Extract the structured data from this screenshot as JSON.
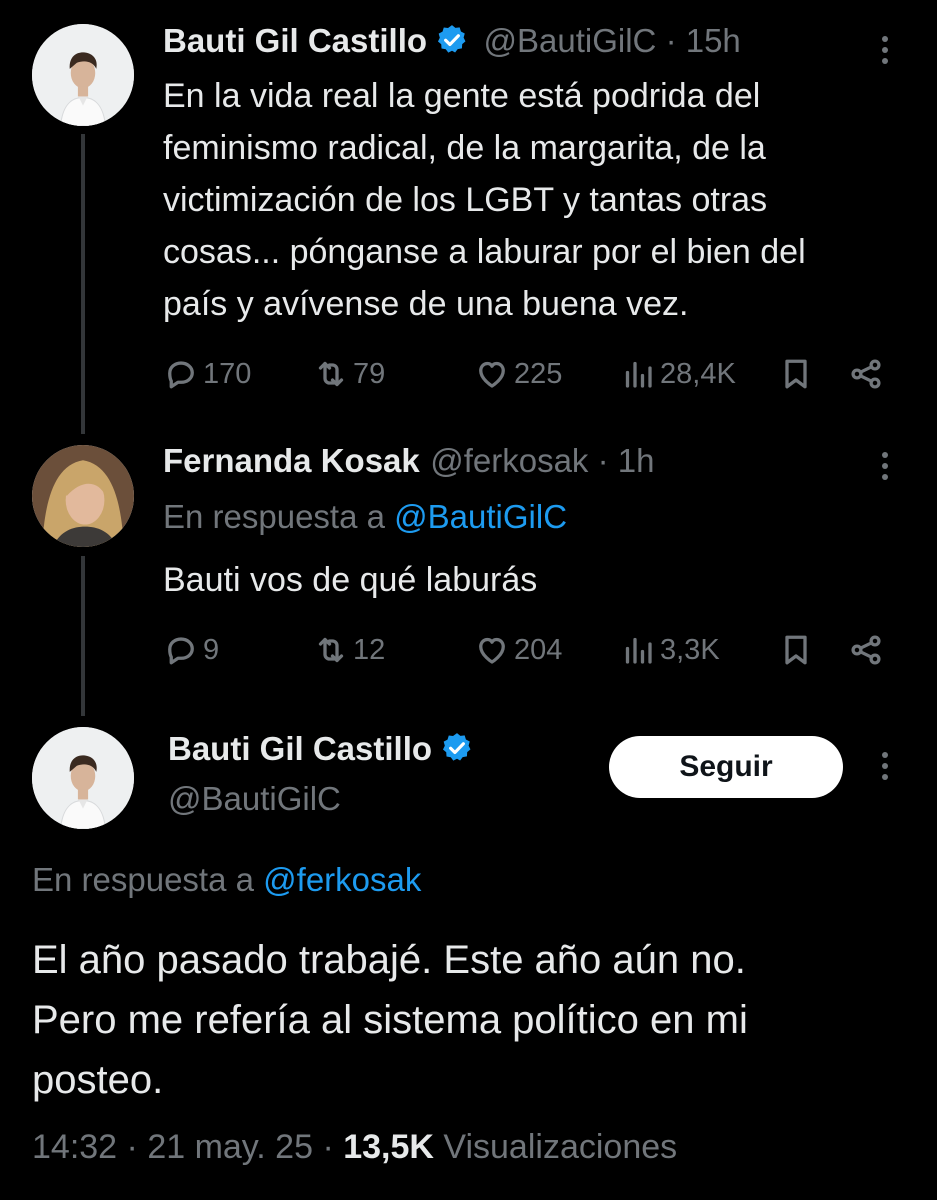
{
  "tweets": [
    {
      "author": "Bauti Gil Castillo",
      "handle": "@BautiGilC",
      "time": "· 15h",
      "lines": [
        "En la vida real la gente está podrida del",
        "feminismo radical, de la margarita, de la",
        "victimización de los LGBT y tantas otras",
        "cosas... pónganse a laburar por el bien del",
        "país y avívense de una buena vez."
      ],
      "replies": "170",
      "retweets": "79",
      "likes": "225",
      "views": "28,4K"
    },
    {
      "author": "Fernanda Kosak",
      "handle": "@ferkosak",
      "time": "· 1h",
      "reply_prefix": "En respuesta a",
      "reply_to": "@BautiGilC",
      "lines": [
        "Bauti vos de qué laburás"
      ],
      "replies": "9",
      "retweets": "12",
      "likes": "204",
      "views": "3,3K"
    }
  ],
  "main": {
    "author": "Bauti Gil Castillo",
    "handle": "@BautiGilC",
    "follow_label": "Seguir",
    "reply_prefix": "En respuesta a",
    "reply_to": "@ferkosak",
    "lines": [
      "El año pasado trabajé. Este año aún no.",
      "Pero me refería al sistema político en mi",
      "posteo."
    ],
    "time": "14:32",
    "date": "21 may. 25",
    "views_count": "13,5K",
    "views_label": "Visualizaciones"
  },
  "colors": {
    "background": "#000000",
    "text": "#e7e9ea",
    "muted": "#71767b",
    "link": "#1d9bf0",
    "verified": "#1d9bf0"
  },
  "icons": [
    "reply-icon",
    "retweet-icon",
    "like-icon",
    "views-icon",
    "bookmark-icon",
    "share-icon",
    "verified-badge-icon",
    "more-options-icon"
  ]
}
